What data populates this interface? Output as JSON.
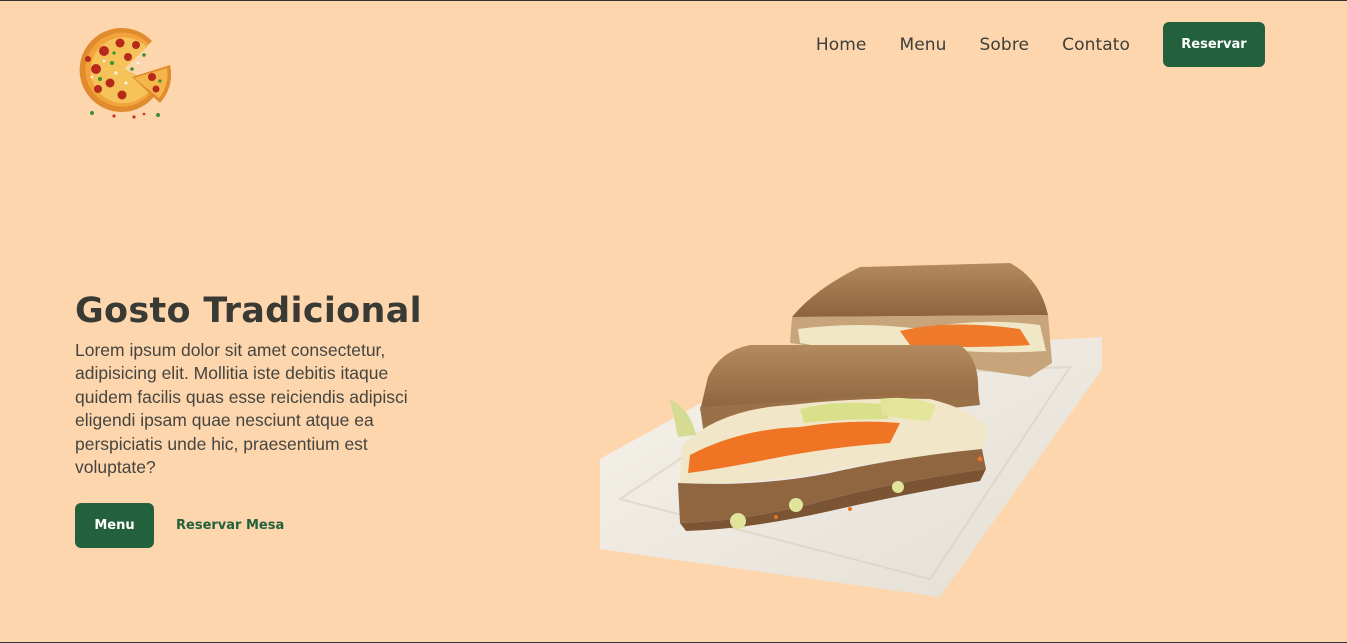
{
  "nav": {
    "items": [
      {
        "label": "Home"
      },
      {
        "label": "Menu"
      },
      {
        "label": "Sobre"
      },
      {
        "label": "Contato"
      }
    ],
    "cta_label": "Reservar"
  },
  "hero": {
    "title": "Gosto Tradicional",
    "description": "Lorem ipsum dolor sit amet consectetur, adipisicing elit. Mollitia iste debitis itaque quidem facilis quas esse reiciendis adipisci eligendi ipsam quae nesciunt atque ea perspiciatis unde hic, praesentium est voluptate?",
    "primary_button": "Menu",
    "secondary_button": "Reservar Mesa"
  },
  "colors": {
    "background": "#fed6ae",
    "accent": "#23613c",
    "text": "#3a3a35"
  },
  "icons": {
    "logo": "pizza-logo-icon",
    "hero_image": "sandwich-plate-image"
  }
}
